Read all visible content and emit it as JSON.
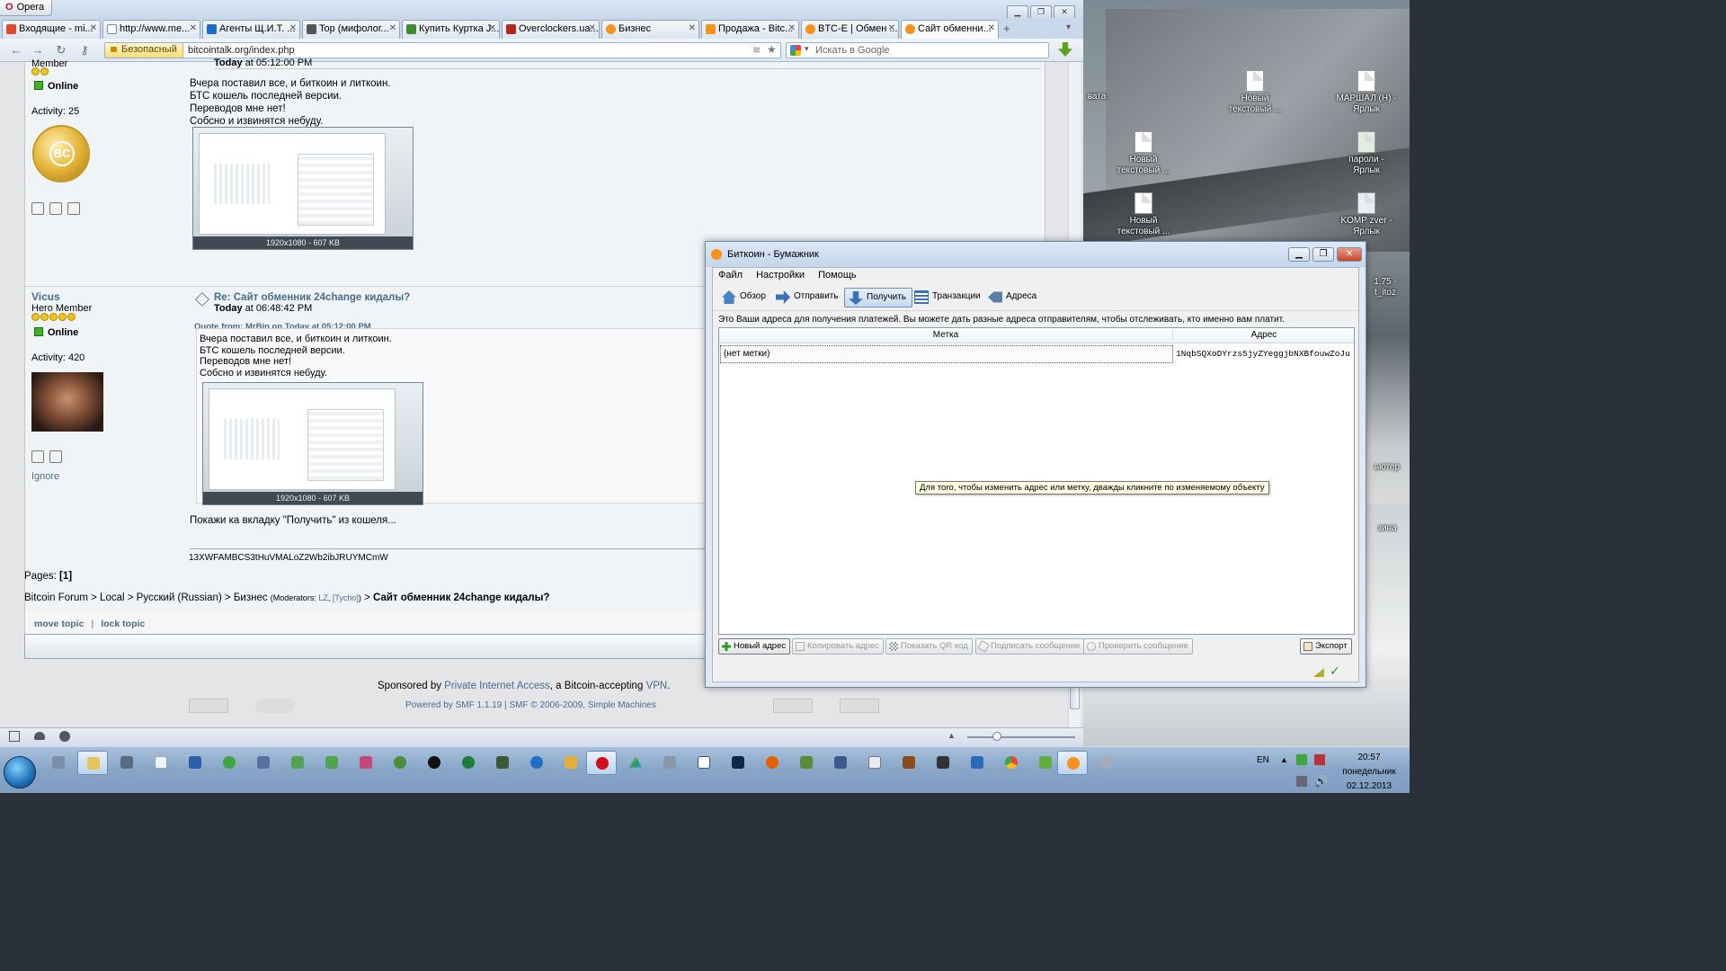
{
  "browser": {
    "app_title": "Opera",
    "tabs": [
      {
        "label": "Входящие - mi...",
        "color": "#e04c2a"
      },
      {
        "label": "http://www.me...",
        "color": "#ffffff"
      },
      {
        "label": "Агенты Щ.И.Т. ...",
        "color": "#1a6dc7"
      },
      {
        "label": "Top (мифолог...",
        "color": "#555555"
      },
      {
        "label": "Купить Куртка J...",
        "color": "#3b8c2e"
      },
      {
        "label": "Overclockers.ua...",
        "color": "#b3261e"
      },
      {
        "label": "Бизнес",
        "color": "#f7931a"
      },
      {
        "label": "Продажа - Bitc...",
        "color": "#f7931a"
      },
      {
        "label": "BTC-E | Обмен ...",
        "color": "#f7931a"
      },
      {
        "label": "Сайт обменни...",
        "color": "#f7931a"
      }
    ],
    "security_label": "Безопасный",
    "url": "bitcointalk.org/index.php",
    "search_placeholder": "Искать в Google"
  },
  "forum": {
    "post1": {
      "rank": "Member",
      "status": "Online",
      "activity": "Activity: 25",
      "time_prefix": "Today",
      "time": "at 05:12:00 PM",
      "lines": [
        "Вчера поставил все, и биткоин и литкоин.",
        "БТС кошель последней версии.",
        "Переводов мне нет!",
        "Собсно и извинятся небуду."
      ],
      "image_caption": "1920x1080 - 607 KB"
    },
    "post2": {
      "username": "Vicus",
      "rank": "Hero Member",
      "status": "Online",
      "activity": "Activity: 420",
      "ignore": "Ignore",
      "subject": "Re: Сайт обменник 24change кидалы?",
      "time_prefix": "Today",
      "time": "at 06:48:42 PM",
      "quote_header": "Quote from: MrBin on Today at 05:12:00 PM",
      "quote_lines": [
        "Вчера поставил все, и биткоин и литкоин.",
        "БТС кошель последней версии.",
        "Переводов мне нет!",
        "Собсно и извинятся небуду."
      ],
      "image_caption": "1920x1080 - 607 KB",
      "reply": "Покажи ка вкладку \"Получить\" из кошеля...",
      "signature": "13XWFAMBCS3tHuVMALoZ2Wb2ibJRUYMCmW"
    },
    "pages": "Pages:",
    "page_current": "[1]",
    "breadcrumb": {
      "items": [
        "Bitcoin Forum",
        "Local",
        "Русский (Russian)",
        "Бизнес"
      ],
      "moderators_label": "(Moderators:",
      "mod1": "LZ",
      "mod2": "[Tycho]",
      "current": "Сайт обменник 24change кидалы?"
    },
    "move_topic": "move topic",
    "lock_topic": "lock topic",
    "sponsored_prefix": "Sponsored by",
    "sponsor": "Private Internet Access",
    "sponsored_mid": ", a Bitcoin-accepting",
    "vpn": "VPN",
    "powered": "Powered by SMF 1.1.19",
    "smf_copy": "SMF © 2006-2009, Simple Machines"
  },
  "wallet": {
    "title": "Биткоин - Бумажник",
    "menu": [
      "Файл",
      "Настройки",
      "Помощь"
    ],
    "toolbar": [
      "Обзор",
      "Отправить",
      "Получить",
      "Транзакции",
      "Адреса"
    ],
    "description": "Это Ваши адреса для получения платежей. Вы можете дать разные адреса отправителям, чтобы отслеживать, кто именно вам платит.",
    "col_label": "Метка",
    "col_address": "Адрес",
    "row_label": "(нет метки)",
    "row_address": "1NqbSQXoDYrzs5jyZYeggjbNXBfouwZoJu",
    "tooltip": "Для того, чтобы изменить адрес или метку, дважды кликните по изменяемому объекту",
    "buttons": [
      "Новый адрес",
      "Копировать адрес",
      "Показать QR код",
      "Подписать сообщение",
      "Проверить сообщение"
    ],
    "export": "Экспорт"
  },
  "desktop": {
    "icons": [
      {
        "label": "вата"
      },
      {
        "label": "Новый текстовый ..."
      },
      {
        "label": "МАРШАЛ (Н) - Ярлык"
      },
      {
        "label": "Новый текстовый ..."
      },
      {
        "label": "пароли - Ярлык"
      },
      {
        "label": "Новый текстовый ..."
      },
      {
        "label": "KOMP zver - Ярлык"
      },
      {
        "label": "1.75 - t_itoz"
      },
      {
        "label": "ьютер"
      },
      {
        "label": "зина"
      }
    ]
  },
  "taskbar": {
    "lang": "EN",
    "time": "20:57",
    "day": "понедельник",
    "date": "02.12.2013"
  }
}
